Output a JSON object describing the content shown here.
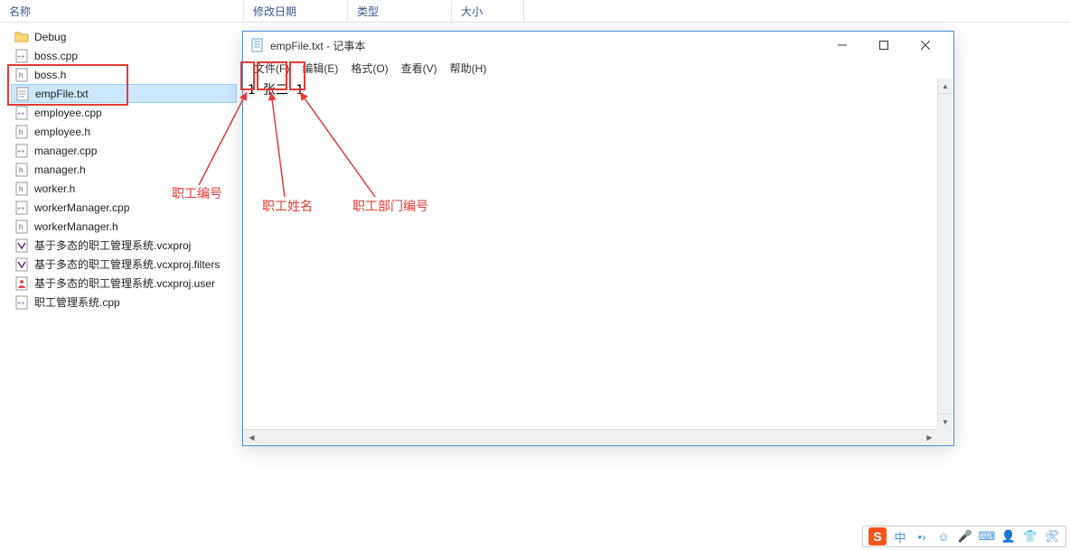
{
  "explorer": {
    "columns": {
      "name": "名称",
      "date": "修改日期",
      "type": "类型",
      "size": "大小"
    },
    "files": [
      {
        "name": "Debug",
        "icon": "folder"
      },
      {
        "name": "boss.cpp",
        "icon": "cpp"
      },
      {
        "name": "boss.h",
        "icon": "h"
      },
      {
        "name": "empFile.txt",
        "icon": "txt",
        "selected": true
      },
      {
        "name": "employee.cpp",
        "icon": "cpp"
      },
      {
        "name": "employee.h",
        "icon": "h"
      },
      {
        "name": "manager.cpp",
        "icon": "cpp"
      },
      {
        "name": "manager.h",
        "icon": "h"
      },
      {
        "name": "worker.h",
        "icon": "h"
      },
      {
        "name": "workerManager.cpp",
        "icon": "cpp"
      },
      {
        "name": "workerManager.h",
        "icon": "h"
      },
      {
        "name": "基于多态的职工管理系统.vcxproj",
        "icon": "vcx"
      },
      {
        "name": "基于多态的职工管理系统.vcxproj.filters",
        "icon": "vcx"
      },
      {
        "name": "基于多态的职工管理系统.vcxproj.user",
        "icon": "vcxu"
      },
      {
        "name": "职工管理系统.cpp",
        "icon": "cpp"
      }
    ]
  },
  "notepad": {
    "title": "empFile.txt - 记事本",
    "menus": [
      "文件(F)",
      "编辑(E)",
      "格式(O)",
      "查看(V)",
      "帮助(H)"
    ],
    "content_parts": {
      "id": "1",
      "name": "张三",
      "dept": "1"
    }
  },
  "annotations": {
    "label1": "职工编号",
    "label2": "职工姓名",
    "label3": "职工部门编号"
  },
  "ime": {
    "chinese": "中"
  }
}
